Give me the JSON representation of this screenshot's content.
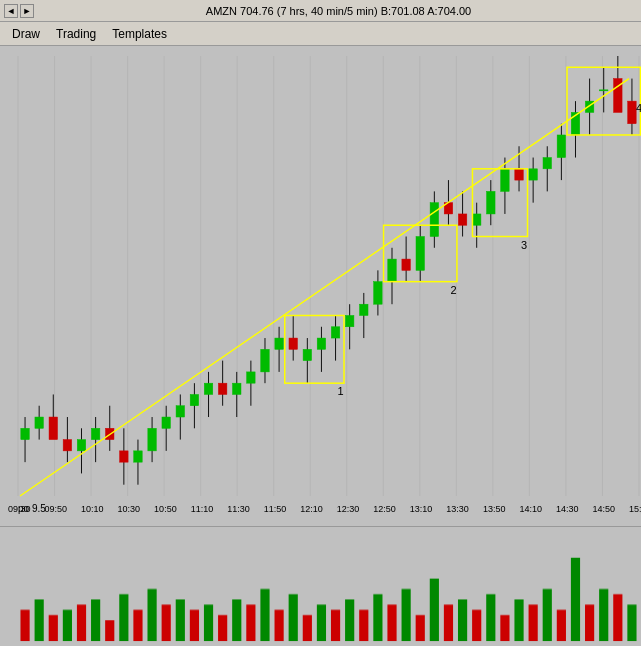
{
  "titlebar": {
    "title": "AMZN 704.76 (7 hrs, 40 min/5 min) B:701.08 A:704.00",
    "controls": [
      "back-icon",
      "forward-icon"
    ]
  },
  "menubar": {
    "items": [
      "Draw",
      "Trading",
      "Templates"
    ]
  },
  "chart": {
    "timeLabels": [
      "09:30",
      "09:50",
      "10:10",
      "10:30",
      "10:50",
      "11:10",
      "11:30",
      "11:50",
      "12:10",
      "12:30",
      "12:50",
      "13:10",
      "13:30",
      "13:50",
      "14:10",
      "14:30",
      "14:50",
      "15:"
    ],
    "priceLabel": "po 9.5",
    "annotations": [
      "1",
      "2",
      "3",
      "4"
    ],
    "trendlineColor": "#ffff00",
    "rectangleColor": "#ffff00"
  },
  "colors": {
    "background": "#c0c0c0",
    "bullCandle": "#00aa00",
    "bearCandle": "#cc0000",
    "trendline": "#ffff00",
    "rectangle": "#ffff00",
    "textColor": "#000000",
    "volumeBull": "#008800",
    "volumeBear": "#cc0000"
  }
}
